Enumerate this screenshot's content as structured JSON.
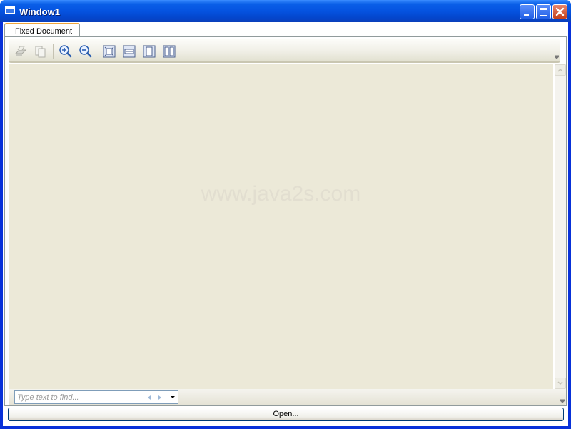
{
  "window": {
    "title": "Window1"
  },
  "tabs": [
    {
      "label": "Fixed Document",
      "selected": true
    }
  ],
  "toolbar": {
    "items": [
      {
        "name": "print",
        "icon": "print-icon",
        "enabled": false
      },
      {
        "name": "copy",
        "icon": "copy-icon",
        "enabled": false
      },
      {
        "name": "zoom-in",
        "icon": "zoom-in-icon",
        "enabled": true
      },
      {
        "name": "zoom-out",
        "icon": "zoom-out-icon",
        "enabled": true
      },
      {
        "name": "actual-size",
        "icon": "actual-size-icon",
        "enabled": true
      },
      {
        "name": "fit-width",
        "icon": "fit-width-icon",
        "enabled": true
      },
      {
        "name": "whole-page",
        "icon": "whole-page-icon",
        "enabled": true
      },
      {
        "name": "two-pages",
        "icon": "two-pages-icon",
        "enabled": true
      }
    ]
  },
  "viewer": {
    "watermark": "www.java2s.com",
    "background": "#ece9d8"
  },
  "find": {
    "placeholder": "Type text to find..."
  },
  "open_button": {
    "label": "Open..."
  },
  "colors": {
    "titlebar": "#0553e0",
    "tab_accent": "#f0a53c"
  }
}
